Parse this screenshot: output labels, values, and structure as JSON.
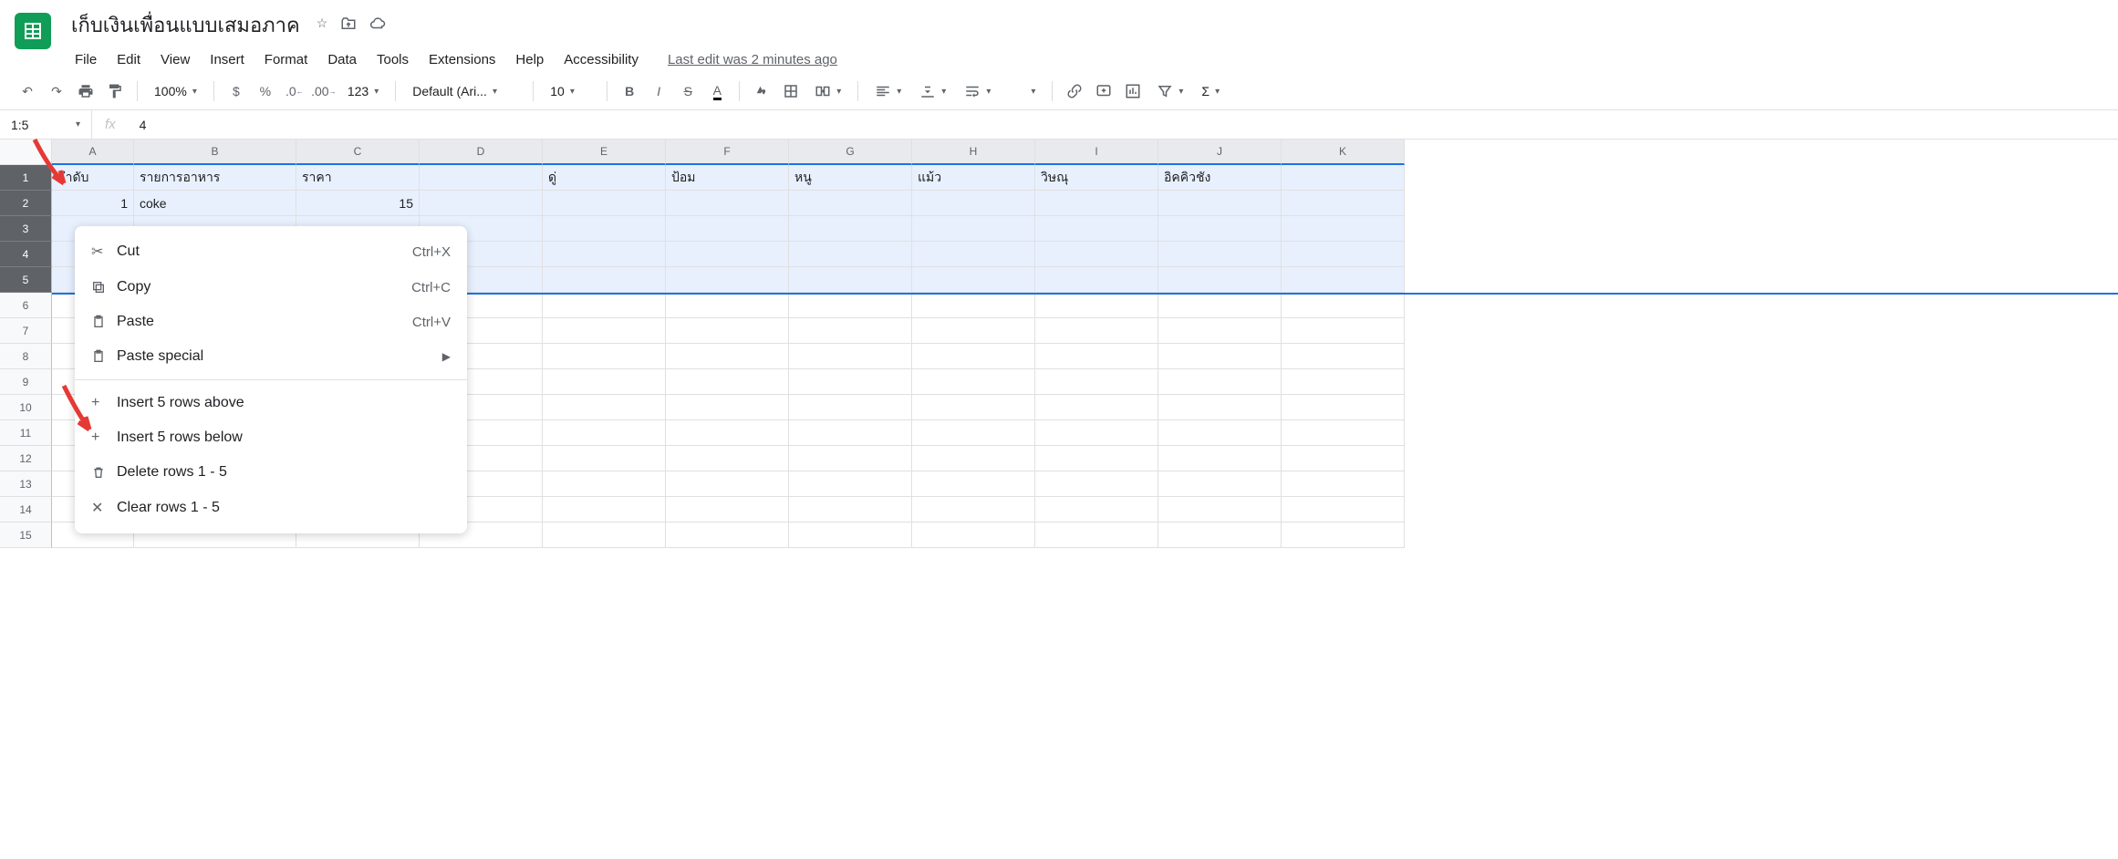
{
  "doc": {
    "title": "เก็บเงินเพื่อนแบบเสมอภาค"
  },
  "menu": {
    "file": "File",
    "edit": "Edit",
    "view": "View",
    "insert": "Insert",
    "format": "Format",
    "data": "Data",
    "tools": "Tools",
    "extensions": "Extensions",
    "help": "Help",
    "accessibility": "Accessibility"
  },
  "last_edit": "Last edit was 2 minutes ago",
  "toolbar": {
    "zoom": "100%",
    "font": "Default (Ari...",
    "font_size": "10"
  },
  "formula_bar": {
    "name_box": "1:5",
    "fx": "fx",
    "value": "4"
  },
  "columns": [
    "A",
    "B",
    "C",
    "D",
    "E",
    "F",
    "G",
    "H",
    "I",
    "J",
    "K"
  ],
  "col_widths": [
    "cw-A",
    "cw-B",
    "cw-C",
    "cw-D",
    "cw-E",
    "cw-F",
    "cw-G",
    "cw-H",
    "cw-I",
    "cw-J",
    "cw-K"
  ],
  "rows": [
    "1",
    "2",
    "3",
    "4",
    "5",
    "6",
    "7",
    "8",
    "9",
    "10",
    "11",
    "12",
    "13",
    "14",
    "15"
  ],
  "selected_rows": [
    0,
    1,
    2,
    3,
    4
  ],
  "cells": {
    "r1": {
      "A": "ลำดับ",
      "B": "รายการอาหาร",
      "C": "ราคา",
      "D": "",
      "E": "ดู่",
      "F": "ป้อม",
      "G": "หนู",
      "H": "แม้ว",
      "I": "วิษณุ",
      "J": "อิคคิวชัง",
      "K": ""
    },
    "r2": {
      "A": "1",
      "B": "coke",
      "C": "15"
    }
  },
  "context_menu": {
    "cut": "Cut",
    "cut_sc": "Ctrl+X",
    "copy": "Copy",
    "copy_sc": "Ctrl+C",
    "paste": "Paste",
    "paste_sc": "Ctrl+V",
    "paste_special": "Paste special",
    "insert_above": "Insert 5 rows above",
    "insert_below": "Insert 5 rows below",
    "delete_rows": "Delete rows 1 - 5",
    "clear_rows": "Clear rows 1 - 5"
  }
}
